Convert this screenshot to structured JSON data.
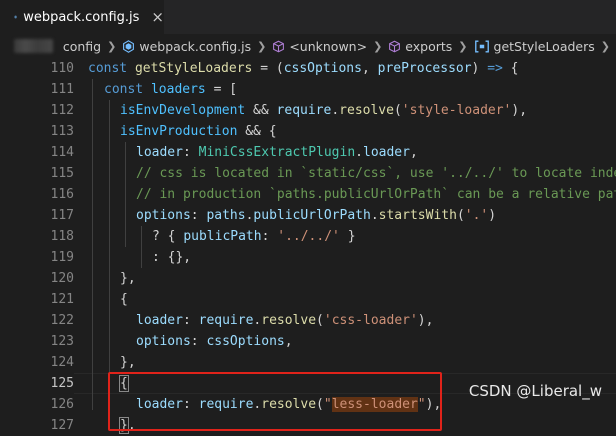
{
  "tab": {
    "label": "webpack.config.js",
    "close": "×"
  },
  "breadcrumbs": [
    {
      "label": "config",
      "icon": "folder"
    },
    {
      "label": "webpack.config.js",
      "icon": "js-file-icon"
    },
    {
      "label": "<unknown>",
      "icon": "cube-icon"
    },
    {
      "label": "exports",
      "icon": "cube-icon"
    },
    {
      "label": "getStyleLoaders",
      "icon": "bracket-icon"
    }
  ],
  "line_numbers": [
    "110",
    "111",
    "112",
    "113",
    "114",
    "115",
    "116",
    "117",
    "118",
    "119",
    "120",
    "121",
    "122",
    "123",
    "124",
    "125",
    "126",
    "127"
  ],
  "active_line": "125",
  "code": {
    "l110": [
      "const",
      "getStyleLoaders",
      " = (",
      "cssOptions",
      ", ",
      "preProcessor",
      ") ",
      "=>",
      " {"
    ],
    "l111": [
      "const",
      "loaders",
      " = ["
    ],
    "l112": [
      "isEnvDevelopment",
      " && ",
      "require",
      ".",
      "resolve",
      "(",
      "'style-loader'",
      "),"
    ],
    "l113": [
      "isEnvProduction",
      " && {"
    ],
    "l114": [
      "loader",
      ": ",
      "MiniCssExtractPlugin",
      ".",
      "loader",
      ","
    ],
    "l115": "// css is located in `static/css`, use '../../' to locate index",
    "l116": "// in production `paths.publicUrlOrPath` can be a relative path",
    "l117": [
      "options",
      ": ",
      "paths",
      ".",
      "publicUrlOrPath",
      ".",
      "startsWith",
      "(",
      "'.'",
      ")"
    ],
    "l118": [
      "? { ",
      "publicPath",
      ": ",
      "'../../'",
      " }"
    ],
    "l119": ": {},",
    "l120": "},",
    "l121": "{",
    "l122": [
      "loader",
      ": ",
      "require",
      ".",
      "resolve",
      "(",
      "'css-loader'",
      "),"
    ],
    "l123": [
      "options",
      ": ",
      "cssOptions",
      ","
    ],
    "l124": "},",
    "l125": "{",
    "l126": [
      "loader",
      ": ",
      "require",
      ".",
      "resolve",
      "(",
      "\"",
      "less-loader",
      "\"",
      "),"
    ],
    "l127": [
      "}",
      ","
    ]
  },
  "watermark": "CSDN @Liberal_w",
  "colors": {
    "background": "#1e1e1e",
    "keyword": "#569cd6",
    "function": "#dcdcaa",
    "variable": "#9cdcfe",
    "string": "#ce9178",
    "comment": "#6a9955",
    "highlight_box": "#e0231a"
  }
}
